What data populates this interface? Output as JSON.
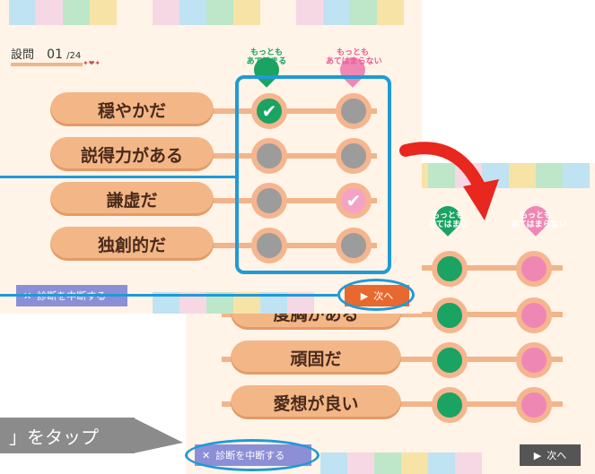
{
  "front": {
    "question_label": "設問",
    "question_number": "01",
    "question_total": "/24",
    "scale_left": "もっとも\nあてはまる",
    "scale_right": "もっとも\nあてはまらない",
    "items": [
      {
        "label": "穏やかだ",
        "left": "checked",
        "right": "unselected"
      },
      {
        "label": "説得力がある",
        "left": "unselected",
        "right": "unselected"
      },
      {
        "label": "謙虚だ",
        "left": "unselected",
        "right": "checked"
      },
      {
        "label": "独創的だ",
        "left": "unselected",
        "right": "unselected"
      }
    ],
    "quit_label": "診断を中断する",
    "next_label": "次へ"
  },
  "back": {
    "scale_left": "もっとも\nあてはまる",
    "scale_right": "もっとも\nあてはまらない",
    "items": [
      {
        "label": "度胸がある"
      },
      {
        "label": "頑固だ"
      },
      {
        "label": "愛想が良い"
      }
    ],
    "quit_label": "診断を中断する",
    "next_label": "次へ"
  },
  "tooltip": {
    "text": "」をタップ"
  },
  "colors": {
    "accent_blue": "#1f9ad6",
    "arrow_red": "#e8271f",
    "pill": "#f3b687",
    "green": "#1aa363",
    "pink": "#ef87b5",
    "gray": "#9c9c9c",
    "quit_button": "#8d8fd6"
  }
}
